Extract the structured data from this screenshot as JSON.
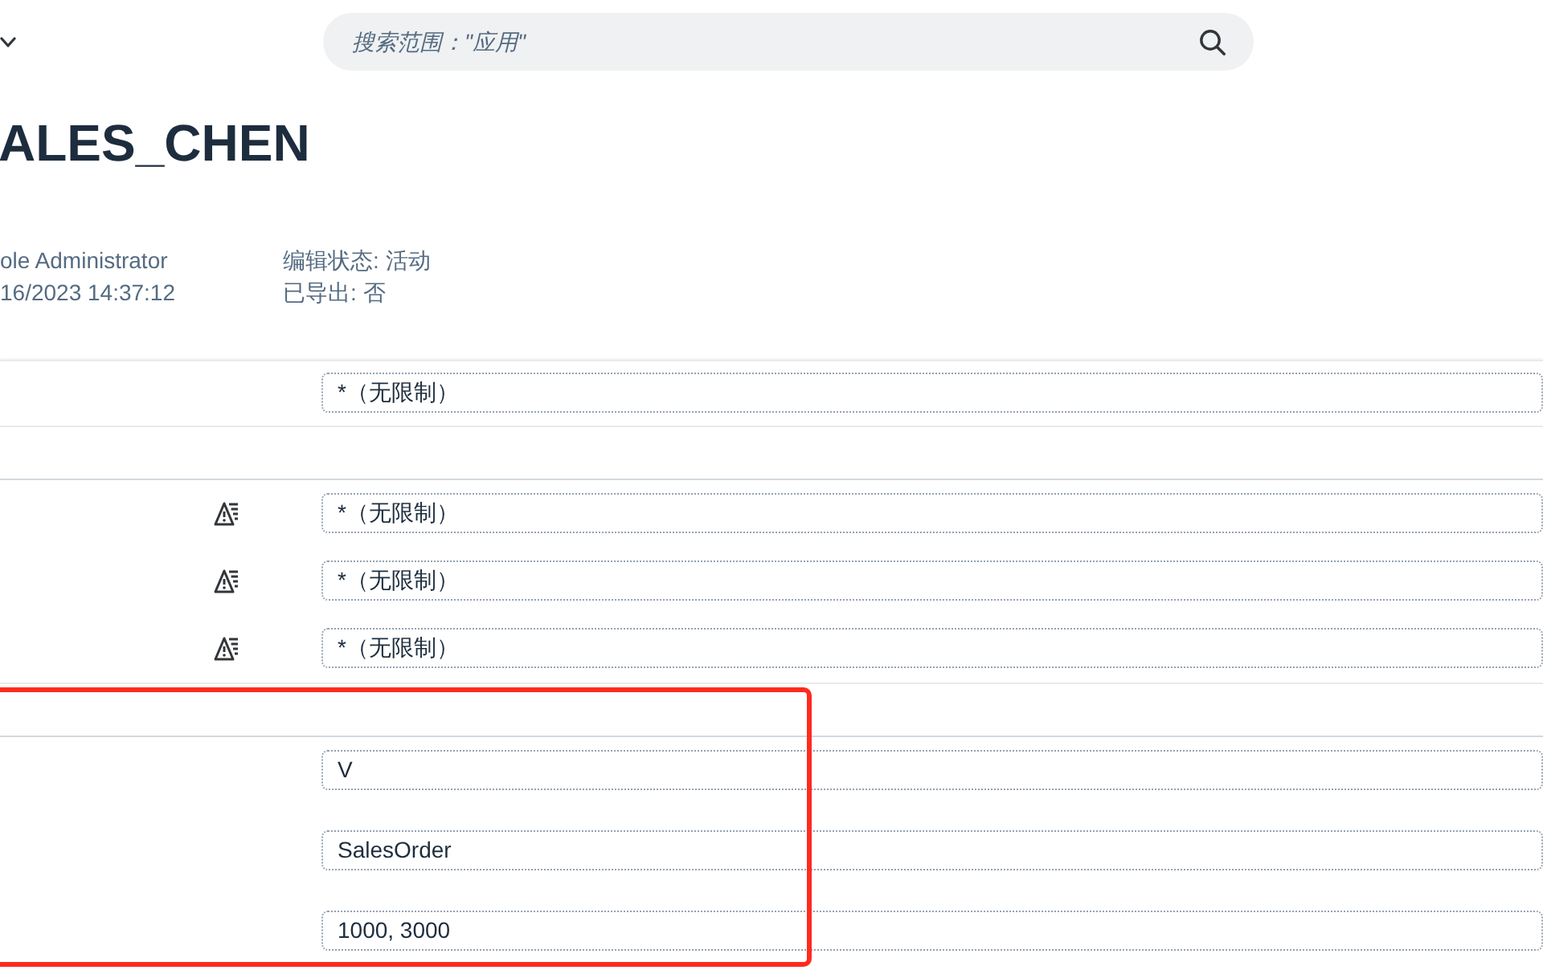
{
  "shell": {
    "search": {
      "placeholder": "搜索范围：\"应用\""
    }
  },
  "header": {
    "title": "ALES_CHEN",
    "details": [
      [
        "ole Administrator",
        "16/2023 14:37:12"
      ],
      [
        "编辑状态: 活动",
        "已导出: 否"
      ]
    ]
  },
  "sections": [
    {
      "highlighted": false,
      "rows": [
        {
          "value": "*（无限制）",
          "value_help": false
        }
      ]
    },
    {
      "highlighted": false,
      "rows": [
        {
          "value": "*（无限制）",
          "value_help": true
        },
        {
          "value": "*（无限制）",
          "value_help": true
        },
        {
          "value": "*（无限制）",
          "value_help": true
        }
      ]
    },
    {
      "highlighted": true,
      "rows": [
        {
          "value": "V",
          "value_help": false
        },
        {
          "value": "SalesOrder",
          "value_help": false
        },
        {
          "value": "1000, 3000",
          "value_help": false
        }
      ]
    }
  ]
}
